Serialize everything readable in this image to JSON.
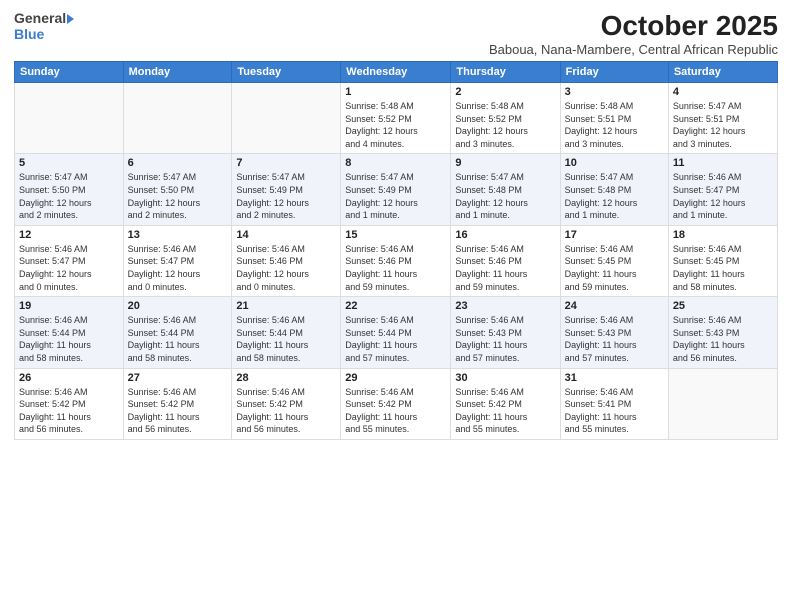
{
  "header": {
    "logo_general": "General",
    "logo_blue": "Blue",
    "month_title": "October 2025",
    "subtitle": "Baboua, Nana-Mambere, Central African Republic"
  },
  "weekdays": [
    "Sunday",
    "Monday",
    "Tuesday",
    "Wednesday",
    "Thursday",
    "Friday",
    "Saturday"
  ],
  "weeks": [
    [
      {
        "day": "",
        "info": ""
      },
      {
        "day": "",
        "info": ""
      },
      {
        "day": "",
        "info": ""
      },
      {
        "day": "1",
        "info": "Sunrise: 5:48 AM\nSunset: 5:52 PM\nDaylight: 12 hours\nand 4 minutes."
      },
      {
        "day": "2",
        "info": "Sunrise: 5:48 AM\nSunset: 5:52 PM\nDaylight: 12 hours\nand 3 minutes."
      },
      {
        "day": "3",
        "info": "Sunrise: 5:48 AM\nSunset: 5:51 PM\nDaylight: 12 hours\nand 3 minutes."
      },
      {
        "day": "4",
        "info": "Sunrise: 5:47 AM\nSunset: 5:51 PM\nDaylight: 12 hours\nand 3 minutes."
      }
    ],
    [
      {
        "day": "5",
        "info": "Sunrise: 5:47 AM\nSunset: 5:50 PM\nDaylight: 12 hours\nand 2 minutes."
      },
      {
        "day": "6",
        "info": "Sunrise: 5:47 AM\nSunset: 5:50 PM\nDaylight: 12 hours\nand 2 minutes."
      },
      {
        "day": "7",
        "info": "Sunrise: 5:47 AM\nSunset: 5:49 PM\nDaylight: 12 hours\nand 2 minutes."
      },
      {
        "day": "8",
        "info": "Sunrise: 5:47 AM\nSunset: 5:49 PM\nDaylight: 12 hours\nand 1 minute."
      },
      {
        "day": "9",
        "info": "Sunrise: 5:47 AM\nSunset: 5:48 PM\nDaylight: 12 hours\nand 1 minute."
      },
      {
        "day": "10",
        "info": "Sunrise: 5:47 AM\nSunset: 5:48 PM\nDaylight: 12 hours\nand 1 minute."
      },
      {
        "day": "11",
        "info": "Sunrise: 5:46 AM\nSunset: 5:47 PM\nDaylight: 12 hours\nand 1 minute."
      }
    ],
    [
      {
        "day": "12",
        "info": "Sunrise: 5:46 AM\nSunset: 5:47 PM\nDaylight: 12 hours\nand 0 minutes."
      },
      {
        "day": "13",
        "info": "Sunrise: 5:46 AM\nSunset: 5:47 PM\nDaylight: 12 hours\nand 0 minutes."
      },
      {
        "day": "14",
        "info": "Sunrise: 5:46 AM\nSunset: 5:46 PM\nDaylight: 12 hours\nand 0 minutes."
      },
      {
        "day": "15",
        "info": "Sunrise: 5:46 AM\nSunset: 5:46 PM\nDaylight: 11 hours\nand 59 minutes."
      },
      {
        "day": "16",
        "info": "Sunrise: 5:46 AM\nSunset: 5:46 PM\nDaylight: 11 hours\nand 59 minutes."
      },
      {
        "day": "17",
        "info": "Sunrise: 5:46 AM\nSunset: 5:45 PM\nDaylight: 11 hours\nand 59 minutes."
      },
      {
        "day": "18",
        "info": "Sunrise: 5:46 AM\nSunset: 5:45 PM\nDaylight: 11 hours\nand 58 minutes."
      }
    ],
    [
      {
        "day": "19",
        "info": "Sunrise: 5:46 AM\nSunset: 5:44 PM\nDaylight: 11 hours\nand 58 minutes."
      },
      {
        "day": "20",
        "info": "Sunrise: 5:46 AM\nSunset: 5:44 PM\nDaylight: 11 hours\nand 58 minutes."
      },
      {
        "day": "21",
        "info": "Sunrise: 5:46 AM\nSunset: 5:44 PM\nDaylight: 11 hours\nand 58 minutes."
      },
      {
        "day": "22",
        "info": "Sunrise: 5:46 AM\nSunset: 5:44 PM\nDaylight: 11 hours\nand 57 minutes."
      },
      {
        "day": "23",
        "info": "Sunrise: 5:46 AM\nSunset: 5:43 PM\nDaylight: 11 hours\nand 57 minutes."
      },
      {
        "day": "24",
        "info": "Sunrise: 5:46 AM\nSunset: 5:43 PM\nDaylight: 11 hours\nand 57 minutes."
      },
      {
        "day": "25",
        "info": "Sunrise: 5:46 AM\nSunset: 5:43 PM\nDaylight: 11 hours\nand 56 minutes."
      }
    ],
    [
      {
        "day": "26",
        "info": "Sunrise: 5:46 AM\nSunset: 5:42 PM\nDaylight: 11 hours\nand 56 minutes."
      },
      {
        "day": "27",
        "info": "Sunrise: 5:46 AM\nSunset: 5:42 PM\nDaylight: 11 hours\nand 56 minutes."
      },
      {
        "day": "28",
        "info": "Sunrise: 5:46 AM\nSunset: 5:42 PM\nDaylight: 11 hours\nand 56 minutes."
      },
      {
        "day": "29",
        "info": "Sunrise: 5:46 AM\nSunset: 5:42 PM\nDaylight: 11 hours\nand 55 minutes."
      },
      {
        "day": "30",
        "info": "Sunrise: 5:46 AM\nSunset: 5:42 PM\nDaylight: 11 hours\nand 55 minutes."
      },
      {
        "day": "31",
        "info": "Sunrise: 5:46 AM\nSunset: 5:41 PM\nDaylight: 11 hours\nand 55 minutes."
      },
      {
        "day": "",
        "info": ""
      }
    ]
  ]
}
